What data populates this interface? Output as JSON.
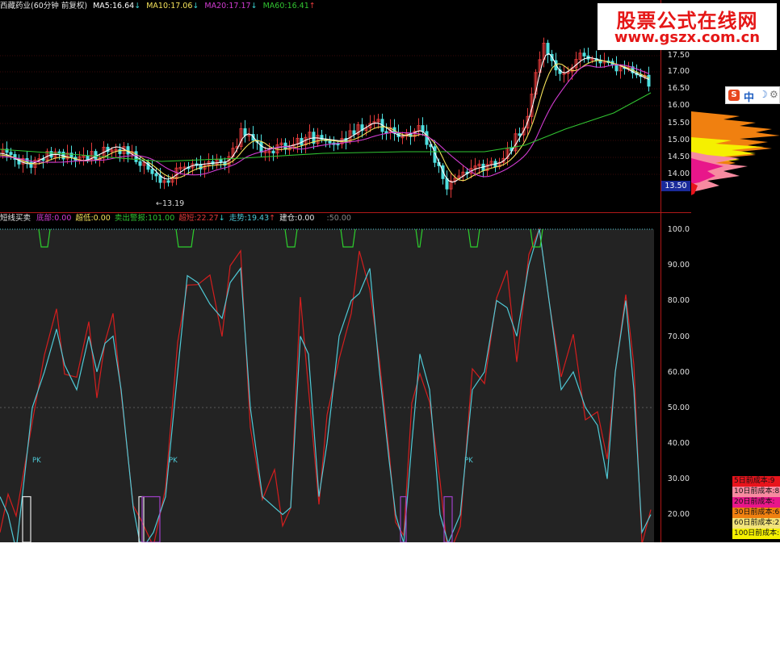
{
  "upper_legend": {
    "title": "西藏药业(60分钟 前复权)",
    "ma5": "MA5:16.64",
    "ma5_arrow": "↓",
    "ma10": "MA10:17.06",
    "ma10_arrow": "↓",
    "ma20": "MA20:17.17",
    "ma20_arrow": "↓",
    "ma60": "MA60:16.41",
    "ma60_arrow": "↑"
  },
  "lower_legend": {
    "title": "短线买卖",
    "dibu": "底部:0.00",
    "chaodi": "超低:0.00",
    "maichu": "卖出警报:101.00",
    "chaoduan": "超短:22.27",
    "chaoduan_arrow": "↓",
    "zoushi": "走势:19.43",
    "zoushi_arrow": "↑",
    "jiancang": "建仓:0.00",
    "fifty": ":50.00"
  },
  "upper_axis": [
    "17.50",
    "17.00",
    "16.50",
    "16.00",
    "15.50",
    "15.00",
    "14.50",
    "14.00"
  ],
  "lower_axis": [
    "100.0",
    "90.00",
    "80.00",
    "70.00",
    "60.00",
    "50.00",
    "40.00",
    "30.00",
    "20.00"
  ],
  "current_price_tag": "13.50",
  "low_annotation": "←13.19",
  "pk_labels": [
    "PK",
    "PK",
    "PK"
  ],
  "watermark": {
    "line1": "股票公式在线网",
    "line2": "www.gszx.com.cn"
  },
  "toolbar": {
    "s_icon": "S",
    "zh_label": "中",
    "moon_icon": "☽",
    "gear_icon": "⚙"
  },
  "cost_legend": [
    {
      "label": "5日前成本:9",
      "color": "#e8141c"
    },
    {
      "label": "10日前成本:8",
      "color": "#f78aa0"
    },
    {
      "label": "20日前成本:",
      "color": "#e8168a"
    },
    {
      "label": "30日前成本:6",
      "color": "#f08010"
    },
    {
      "label": "60日前成本:2",
      "color": "#f2e37a"
    },
    {
      "label": "100日前成本:",
      "color": "#f5f000"
    }
  ],
  "colors": {
    "ma5": "#ffffff",
    "ma10": "#f5e25b",
    "ma20": "#d23cd2",
    "ma60": "#31c431",
    "up_candle": "#e23a3a",
    "down_candle": "#4fe0e0",
    "fast_line": "#d41e1e",
    "slow_line": "#4fc9d6",
    "signal_green": "#2dcf2d",
    "axis_red": "#b01818"
  }
}
